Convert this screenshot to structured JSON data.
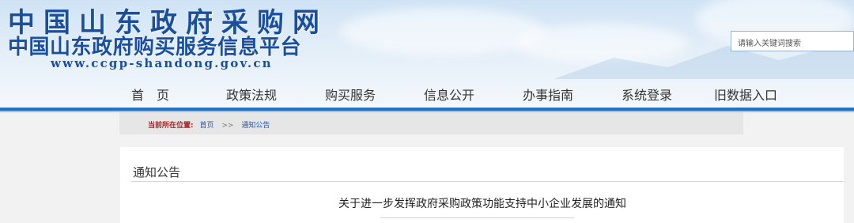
{
  "header": {
    "title": "中国山东政府采购网",
    "subtitle": "中国山东政府购买服务信息平台",
    "url": "www.ccgp-shandong.gov.cn",
    "search_placeholder": "请输入关键词搜索"
  },
  "nav": {
    "items": [
      "首　页",
      "政策法规",
      "购买服务",
      "信息公开",
      "办事指南",
      "系统登录",
      "旧数据入口"
    ]
  },
  "breadcrumb": {
    "label": "当前所在位置:",
    "home": "首页",
    "separator": ">>",
    "current": "通知公告"
  },
  "content": {
    "section_title": "通知公告",
    "article_title": "关于进一步发挥政府采购政策功能支持中小企业发展的通知"
  },
  "colors": {
    "brand_blue": "#1a4fa0",
    "nav_bar": "#2472c8",
    "breadcrumb_label": "#b02020"
  }
}
